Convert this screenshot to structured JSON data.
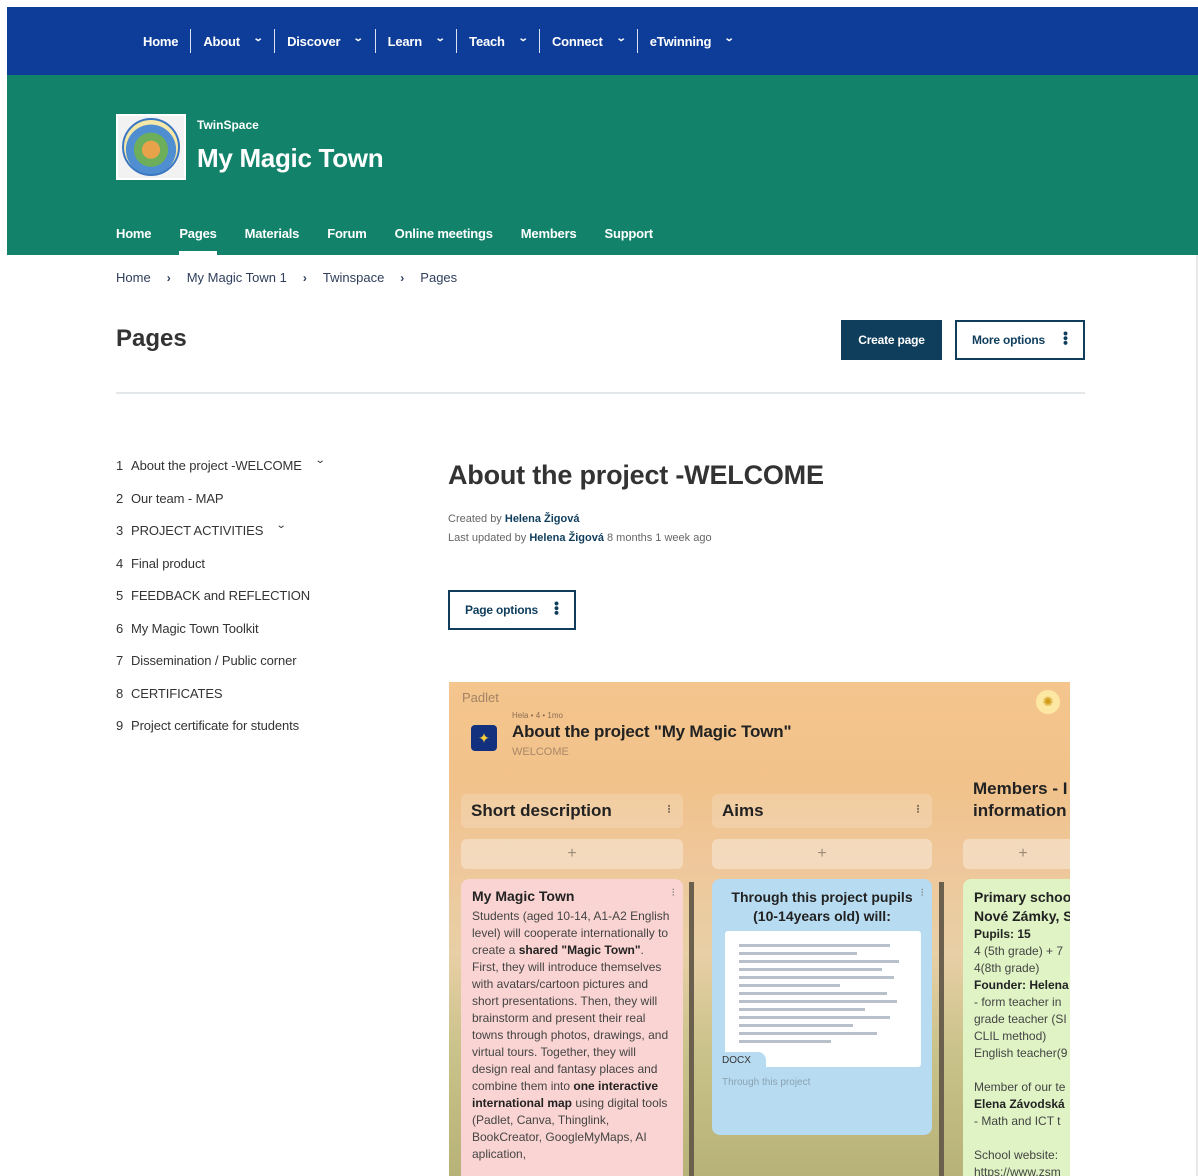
{
  "topnav": {
    "items": [
      {
        "label": "Home",
        "dropdown": false
      },
      {
        "label": "About",
        "dropdown": true
      },
      {
        "label": "Discover",
        "dropdown": true
      },
      {
        "label": "Learn",
        "dropdown": true
      },
      {
        "label": "Teach",
        "dropdown": true
      },
      {
        "label": "Connect",
        "dropdown": true
      },
      {
        "label": "eTwinning",
        "dropdown": true
      }
    ]
  },
  "banner": {
    "subtitle": "TwinSpace",
    "title": "My Magic Town",
    "tabs": [
      "Home",
      "Pages",
      "Materials",
      "Forum",
      "Online meetings",
      "Members",
      "Support"
    ],
    "active_tab": "Pages"
  },
  "breadcrumb": [
    "Home",
    "My Magic Town 1",
    "Twinspace",
    "Pages"
  ],
  "header": {
    "title": "Pages",
    "create_label": "Create page",
    "more_label": "More options"
  },
  "sidebar": {
    "items": [
      {
        "num": "1",
        "label": "About the project -WELCOME",
        "expandable": true
      },
      {
        "num": "2",
        "label": "Our team - MAP",
        "expandable": false
      },
      {
        "num": "3",
        "label": "PROJECT ACTIVITIES",
        "expandable": true
      },
      {
        "num": "4",
        "label": "Final product",
        "expandable": false
      },
      {
        "num": "5",
        "label": "FEEDBACK and REFLECTION",
        "expandable": false
      },
      {
        "num": "6",
        "label": "My Magic Town Toolkit",
        "expandable": false
      },
      {
        "num": "7",
        "label": "Dissemination / Public corner",
        "expandable": false
      },
      {
        "num": "8",
        "label": "CERTIFICATES",
        "expandable": false
      },
      {
        "num": "9",
        "label": "Project certificate for students",
        "expandable": false
      }
    ]
  },
  "content": {
    "title": "About the project -WELCOME",
    "created_prefix": "Created by",
    "created_author": "Helena Žigová",
    "updated_prefix": "Last updated by",
    "updated_author": "Helena Žigová",
    "updated_ago": "8 months 1 week ago",
    "page_options_label": "Page options"
  },
  "padlet": {
    "brand": "Padlet",
    "meta_small": "Hela • 4 • 1mo",
    "title": "About the project \"My Magic Town\"",
    "subtitle": "WELCOME",
    "columns": [
      "Short description",
      "Aims",
      "Members - I information"
    ],
    "add_symbol": "+",
    "card1": {
      "title": "My Magic Town",
      "p1": "Students (aged 10-14, A1-A2 English level) will cooperate internationally to create a ",
      "b1": "shared \"Magic Town\"",
      "p2": ". First, they will introduce themselves with avatars/cartoon pictures and short presentations. Then, they will brainstorm and present their real towns through photos, drawings, and virtual tours. Together, they will design real and fantasy places and combine them into ",
      "b2": "one interactive international map",
      "p3": " using digital tools (Padlet, Canva, Thinglink, BookCreator, GoogleMyMaps, AI aplication,"
    },
    "card2": {
      "title": "Through this project pupils (10-14years old) will:",
      "file_type": "DOCX",
      "caption": "Through this project"
    },
    "card3": {
      "line1": "Primary schoo",
      "line2": "Nové Zámky, S",
      "pupils": "Pupils: 15",
      "grade1": "4 (5th grade) + 7",
      "grade2": "4(8th grade)",
      "founder": "Founder: Helena",
      "role1": "- form teacher in",
      "role2": "grade teacher (SI",
      "role3": "CLIL method)",
      "role4": "English teacher(9",
      "member_label": "Member of our te",
      "member_name": "Elena Závodská",
      "member_role": "- Math and ICT t",
      "website_label": "School website:",
      "website_url": "https://www.zsm"
    }
  },
  "colors": {
    "topnav_bg": "#0d3d98",
    "banner_bg": "#12836a",
    "primary_button": "#0f3d5c"
  }
}
